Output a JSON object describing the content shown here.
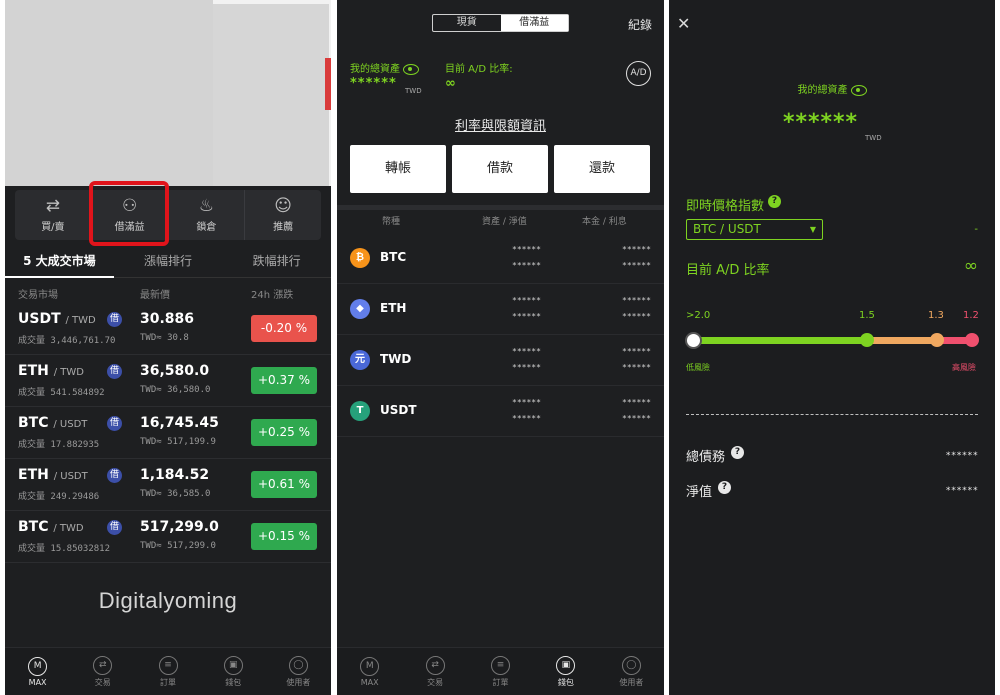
{
  "screen1": {
    "quick_actions": [
      {
        "label": "買/賣",
        "icon": "buy-sell-icon"
      },
      {
        "label": "借滿益",
        "icon": "borrow-icon"
      },
      {
        "label": "鎖倉",
        "icon": "piggy-bank-icon"
      },
      {
        "label": "推薦",
        "icon": "referral-icon"
      }
    ],
    "tabs": [
      "5 大成交市場",
      "漲幅排行",
      "跌幅排行"
    ],
    "columns": {
      "market": "交易市場",
      "price": "最新價",
      "change": "24h 漲跌"
    },
    "borrow_badge": "借",
    "markets": [
      {
        "base": "USDT",
        "quote": "/ TWD",
        "volume": "成交量 3,446,761.70",
        "price": "30.886",
        "twd": "TWD≈ 30.8",
        "change": "-0.20 %",
        "direction": "down"
      },
      {
        "base": "ETH",
        "quote": "/ TWD",
        "volume": "成交量 541.584892",
        "price": "36,580.0",
        "twd": "TWD≈ 36,580.0",
        "change": "+0.37 %",
        "direction": "up"
      },
      {
        "base": "BTC",
        "quote": "/ USDT",
        "volume": "成交量 17.882935",
        "price": "16,745.45",
        "twd": "TWD≈ 517,199.9",
        "change": "+0.25 %",
        "direction": "up"
      },
      {
        "base": "ETH",
        "quote": "/ USDT",
        "volume": "成交量 249.29486",
        "price": "1,184.52",
        "twd": "TWD≈ 36,585.0",
        "change": "+0.61 %",
        "direction": "up"
      },
      {
        "base": "BTC",
        "quote": "/ TWD",
        "volume": "成交量 15.85032812",
        "price": "517,299.0",
        "twd": "TWD≈ 517,299.0",
        "change": "+0.15 %",
        "direction": "up"
      }
    ],
    "watermark": "Digitalyoming",
    "nav": [
      {
        "label": "MAX",
        "icon": "max-logo-icon",
        "active": true
      },
      {
        "label": "交易",
        "icon": "trade-icon",
        "active": false
      },
      {
        "label": "訂單",
        "icon": "orders-icon",
        "active": false
      },
      {
        "label": "錢包",
        "icon": "wallet-icon",
        "active": false
      },
      {
        "label": "使用者",
        "icon": "user-icon",
        "active": false
      }
    ]
  },
  "screen2": {
    "segment": {
      "spot": "現貨",
      "margin": "借滿益"
    },
    "record": "紀錄",
    "total_assets_label": "我的總資產",
    "total_assets_value": "******",
    "total_assets_unit": "TWD",
    "ad_ratio_label": "目前 A/D 比率:",
    "ad_ratio_value": "∞",
    "ad_button": "A/D",
    "rate_link": "利率與限額資訊",
    "actions": [
      "轉帳",
      "借款",
      "還款"
    ],
    "table_headers": {
      "coin": "幣種",
      "assets": "資產 / 淨值",
      "principal": "本金 / 利息"
    },
    "mask": "******",
    "coins": [
      {
        "name": "BTC",
        "symbol": "₿",
        "color": "#f7931a"
      },
      {
        "name": "ETH",
        "symbol": "◆",
        "color": "#627eea"
      },
      {
        "name": "TWD",
        "symbol": "元",
        "color": "#4a68d8"
      },
      {
        "name": "USDT",
        "symbol": "T",
        "color": "#26a17b"
      }
    ],
    "nav": [
      {
        "label": "MAX",
        "icon": "max-logo-icon",
        "active": false
      },
      {
        "label": "交易",
        "icon": "trade-icon",
        "active": false
      },
      {
        "label": "訂單",
        "icon": "orders-icon",
        "active": false
      },
      {
        "label": "錢包",
        "icon": "wallet-icon",
        "active": true
      },
      {
        "label": "使用者",
        "icon": "user-icon",
        "active": false
      }
    ]
  },
  "screen3": {
    "total_assets_label": "我的總資產",
    "total_assets_value": "******",
    "total_assets_unit": "TWD",
    "index_label": "即時價格指數",
    "pair_select": "BTC / USDT",
    "index_value": "-",
    "ad_ratio_label": "目前 A/D 比率",
    "ad_ratio_value": "∞",
    "ticks": [
      ">2.0",
      "1.5",
      "1.3",
      "1.2"
    ],
    "low_risk": "低風險",
    "high_risk": "高風險",
    "total_debt_label": "總債務",
    "total_debt_value": "******",
    "net_value_label": "淨值",
    "net_value_value": "******",
    "colors": {
      "green": "#7ed321",
      "orange": "#f0a860",
      "red": "#f0506e"
    }
  }
}
